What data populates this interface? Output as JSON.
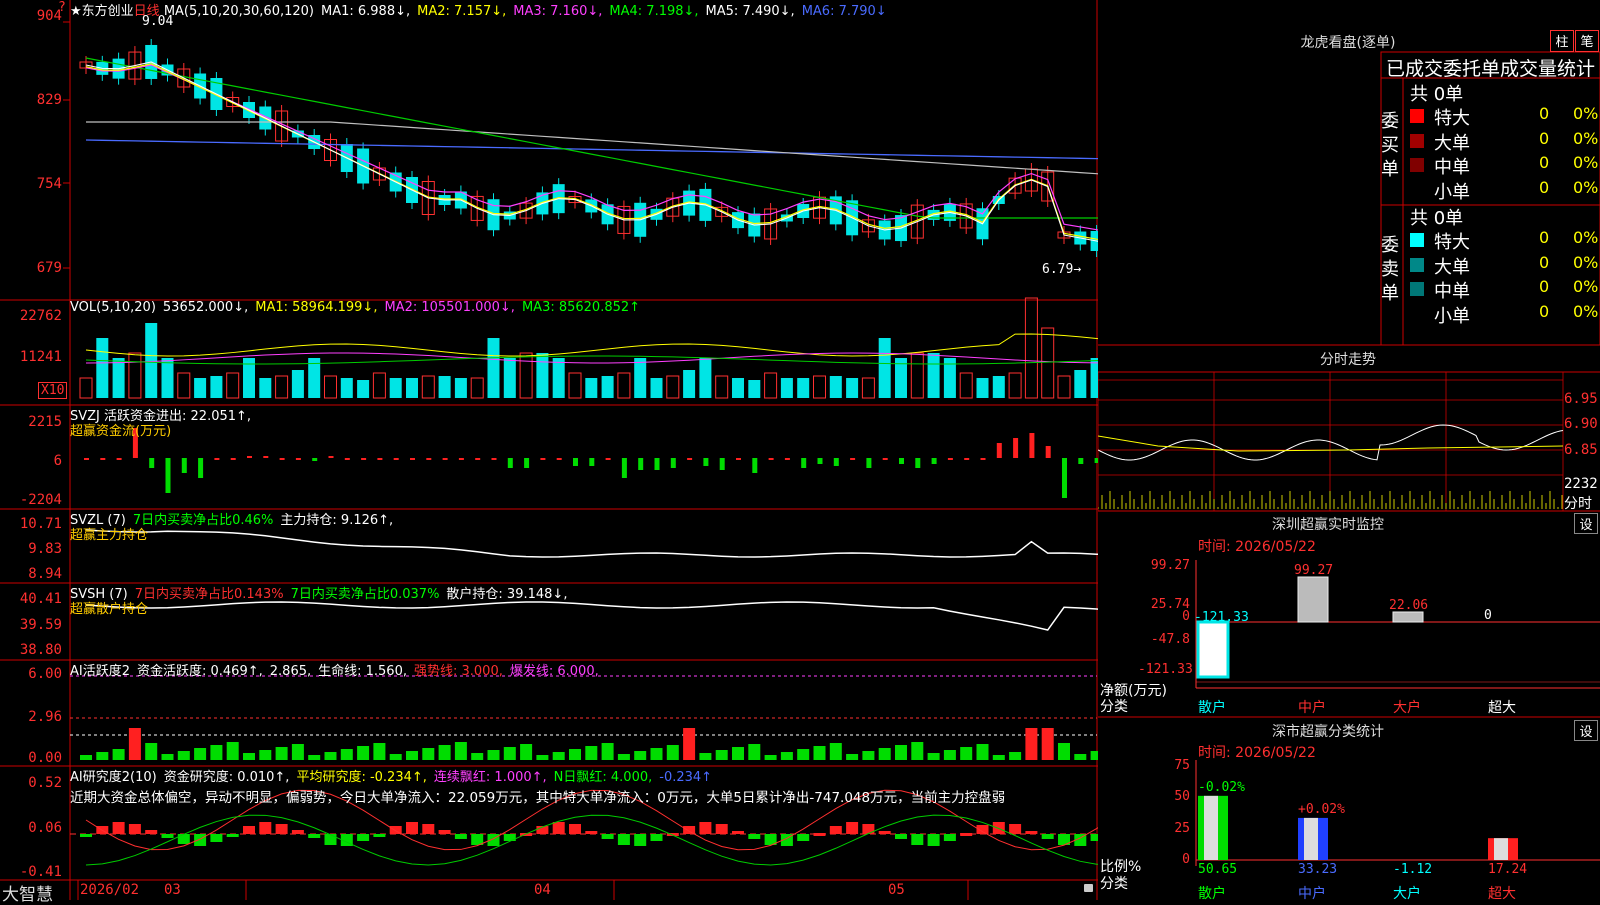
{
  "stock": {
    "name": "★东方创业",
    "period": "日线",
    "ma_line": [
      {
        "t": "MA(5,10,20,30,60,120)",
        "c": "wht"
      },
      {
        "t": "MA1: 6.988↓,",
        "c": "wht"
      },
      {
        "t": "MA2: 7.157↓,",
        "c": "yel"
      },
      {
        "t": "MA3: 7.160↓,",
        "c": "mag"
      },
      {
        "t": "MA4: 7.198↓,",
        "c": "grn"
      },
      {
        "t": "MA5: 7.490↓,",
        "c": "wht"
      },
      {
        "t": "MA6: 7.790↓",
        "c": "blu"
      }
    ],
    "high_mark": "9.04",
    "low_mark": "6.79",
    "price_axis": [
      "904",
      "829",
      "754",
      "679"
    ],
    "top_right_marker": "?"
  },
  "vol": {
    "line": [
      {
        "t": "VOL(5,10,20)",
        "c": "wht"
      },
      {
        "t": "53652.000↓,",
        "c": "wht"
      },
      {
        "t": "MA1: 58964.199↓,",
        "c": "yel"
      },
      {
        "t": "MA2: 105501.000↓,",
        "c": "mag"
      },
      {
        "t": "MA3: 85620.852↑",
        "c": "grn"
      }
    ],
    "axis": [
      "22762",
      "11241"
    ],
    "unit": "X10"
  },
  "svzj": {
    "line": [
      {
        "t": "SVZJ  活跃资金进出: 22.051↑,",
        "c": "wht"
      }
    ],
    "sub": "超赢资金流(万元)",
    "axis": [
      "2215",
      "6",
      "-2204"
    ]
  },
  "svzl": {
    "line": [
      {
        "t": "SVZL (7)",
        "c": "wht"
      },
      {
        "t": "7日内买卖净占比0.46%",
        "c": "grn"
      },
      {
        "t": "主力持仓: 9.126↑,",
        "c": "wht"
      }
    ],
    "sub": "超赢主力持仓",
    "axis": [
      "10.71",
      "9.83",
      "8.94"
    ]
  },
  "svsh": {
    "line": [
      {
        "t": "SVSH (7)",
        "c": "wht"
      },
      {
        "t": "7日内买卖净占比0.143%",
        "c": "red"
      },
      {
        "t": "7日内买卖净占比0.037%",
        "c": "grn"
      },
      {
        "t": "散户持仓: 39.148↓,",
        "c": "wht"
      }
    ],
    "sub": "超赢散户持仓",
    "axis": [
      "40.41",
      "39.59",
      "38.80"
    ]
  },
  "ai_active": {
    "line": [
      {
        "t": "AI活跃度2",
        "c": "wht"
      },
      {
        "t": "资金活跃度: 0.469↑,",
        "c": "wht"
      },
      {
        "t": "2.865,",
        "c": "wht"
      },
      {
        "t": "生命线: 1.560,",
        "c": "wht"
      },
      {
        "t": "强势线: 3.000,",
        "c": "red"
      },
      {
        "t": "爆发线: 6.000,",
        "c": "mag"
      }
    ],
    "axis": [
      "6.00",
      "2.96",
      "0.00"
    ]
  },
  "ai_research": {
    "line": [
      {
        "t": "AI研究度2(10)",
        "c": "wht"
      },
      {
        "t": "资金研究度: 0.010↑,",
        "c": "wht"
      },
      {
        "t": "平均研究度: -0.234↑,",
        "c": "yel"
      },
      {
        "t": "连续飘红: 1.000↑,",
        "c": "mag"
      },
      {
        "t": "N日飘红: 4.000,",
        "c": "grn"
      },
      {
        "t": "-0.234↑",
        "c": "blu"
      }
    ],
    "comment": "近期大资金总体偏空，异动不明显，偏弱势，今日大单净流入：22.059万元，其中特大单净流入：0万元，大单5日累计净出-747.048万元，当前主力控盘弱",
    "axis": [
      "0.52",
      "0.06",
      "-0.41"
    ]
  },
  "bottom_axis": {
    "brand": "大智慧",
    "labels": [
      "2026/02",
      "03",
      "04",
      "05"
    ]
  },
  "longhu": {
    "title": "龙虎看盘(逐单)",
    "btn1": "柱",
    "btn2": "笔",
    "header": "已成交委托单成交量统计",
    "buy_label": "委买单",
    "sell_label": "委卖单",
    "buy_total": "共 0单",
    "sell_total": "共 0单",
    "rows_buy": [
      {
        "name": "特大",
        "v": "0",
        "p": "0%",
        "color": "#ff0000"
      },
      {
        "name": "大单",
        "v": "0",
        "p": "0%",
        "color": "#a00000"
      },
      {
        "name": "中单",
        "v": "0",
        "p": "0%",
        "color": "#800000"
      },
      {
        "name": "小单",
        "v": "0",
        "p": "0%",
        "color": ""
      }
    ],
    "rows_sell": [
      {
        "name": "特大",
        "v": "0",
        "p": "0%",
        "color": "#00ffff"
      },
      {
        "name": "大单",
        "v": "0",
        "p": "0%",
        "color": "#008888"
      },
      {
        "name": "中单",
        "v": "0",
        "p": "0%",
        "color": "#007777"
      },
      {
        "name": "小单",
        "v": "0",
        "p": "0%",
        "color": ""
      }
    ]
  },
  "intraday": {
    "title": "分时走势",
    "axis": [
      "6.95",
      "6.90",
      "6.85"
    ],
    "vol_max": "2232",
    "vol_label": "分时"
  },
  "sz_monitor": {
    "title": "深圳超赢实时监控",
    "set": "设",
    "time": "时间: 2026/05/22",
    "axis": [
      "99.27",
      "25.74",
      "0",
      "-47.8",
      "-121.33"
    ],
    "ylabel1": "净额(万元)",
    "ylabel2": "分类",
    "categories": [
      "散户",
      "中户",
      "大户",
      "超大"
    ],
    "values": [
      -121.33,
      99.27,
      22.06,
      0
    ],
    "value_labels": [
      "-121.33",
      "99.27",
      "22.06",
      "0"
    ]
  },
  "sz_category": {
    "title": "深市超赢分类统计",
    "set": "设",
    "time": "时间: 2026/05/22",
    "axis": [
      "75",
      "50",
      "25",
      "0"
    ],
    "ylabel1": "比例%",
    "ylabel2": "分类",
    "categories": [
      "散户",
      "中户",
      "大户",
      "超大"
    ],
    "values": [
      50.65,
      33.23,
      -1.12,
      17.24
    ],
    "value_labels": [
      "50.65",
      "33.23",
      "-1.12",
      "17.24"
    ],
    "change_labels": [
      "-0.02%",
      "+0.02%",
      "",
      ""
    ]
  }
}
